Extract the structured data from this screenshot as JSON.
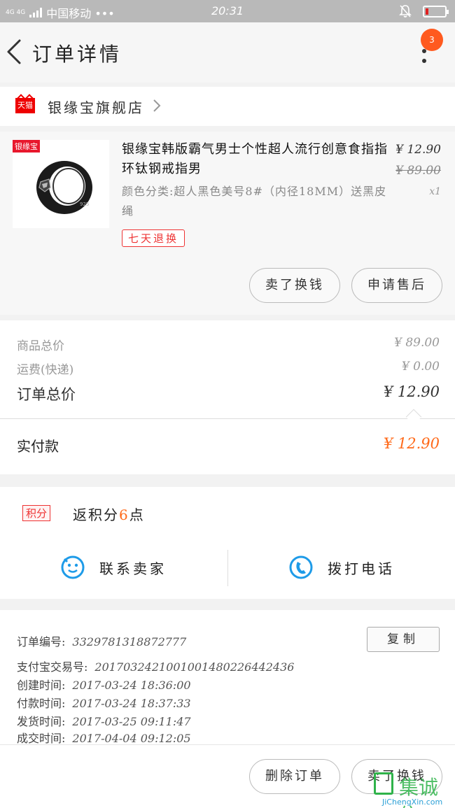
{
  "status_bar": {
    "network": "4G 4G",
    "carrier": "中国移动 •••",
    "time": "20:31"
  },
  "header": {
    "title": "订单详情",
    "notification_count": "3"
  },
  "shop": {
    "platform_badge": "天猫",
    "name": "银缘宝旗舰店"
  },
  "product": {
    "brand_tag": "银缘宝",
    "title": "银缘宝韩版霸气男士个性超人流行创意食指指环钛钢戒指男",
    "attributes": "颜色分类:超人黑色美号8#（内径18MM）送黑皮绳",
    "price": "¥ 12.90",
    "original_price": "¥ 89.00",
    "quantity": "x1",
    "service_tag": "七天退换",
    "buttons": {
      "resell": "卖了换钱",
      "after_sales": "申请售后"
    }
  },
  "totals": {
    "goods_total_label": "商品总价",
    "goods_total_value": "¥ 89.00",
    "shipping_label": "运费(快递)",
    "shipping_value": "¥ 0.00",
    "order_total_label": "订单总价",
    "order_total_value": "¥ 12.90",
    "paid_label": "实付款",
    "paid_value": "¥ 12.90"
  },
  "points": {
    "badge": "积分",
    "text_prefix": "返积分",
    "amount": "6",
    "text_suffix": "点"
  },
  "actions": {
    "contact_seller": "联系卖家",
    "call": "拨打电话"
  },
  "order_info": {
    "order_no_label": "订单编号:",
    "order_no": "3329781318872777",
    "copy_button": "复制",
    "alipay_label": "支付宝交易号:",
    "alipay_no": "2017032421001001480226442436",
    "created_label": "创建时间:",
    "created": "2017-03-24 18:36:00",
    "paid_label": "付款时间:",
    "paid": "2017-03-24 18:37:33",
    "shipped_label": "发货时间:",
    "shipped": "2017-03-25 09:11:47",
    "completed_label": "成交时间:",
    "completed": "2017-04-04 09:12:05"
  },
  "bottom_bar": {
    "delete_order": "删除订单",
    "resell": "卖了换钱"
  },
  "watermark": {
    "text": "集诚信",
    "url": "JiChengXin.com"
  },
  "colors": {
    "accent_orange": "#ff6a1a",
    "tmall_red": "#e00000",
    "notification_badge": "#ff5a1f",
    "call_icon_blue": "#1e9be8"
  }
}
